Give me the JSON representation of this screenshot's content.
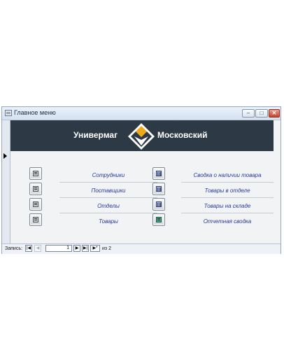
{
  "window": {
    "title": "Главное меню",
    "controls": {
      "minimize": "–",
      "maximize": "□",
      "close": "✕"
    }
  },
  "header": {
    "logo_left": "Универмаг",
    "logo_right": "Московский"
  },
  "menu": {
    "left": [
      {
        "label": "Сотрудники",
        "icon": "form-icon"
      },
      {
        "label": "Поставщики",
        "icon": "form-icon"
      },
      {
        "label": "Отделы",
        "icon": "form-icon"
      },
      {
        "label": "Товары",
        "icon": "form-icon"
      }
    ],
    "right": [
      {
        "label": "Сводка о наличии товара",
        "icon": "report-icon"
      },
      {
        "label": "Товары в отделе",
        "icon": "report-icon"
      },
      {
        "label": "Товары на складе",
        "icon": "report-icon"
      },
      {
        "label": "Отчетная сводка",
        "icon": "book-icon"
      }
    ]
  },
  "navigation": {
    "label": "Запись:",
    "current": "1",
    "of_label": "из",
    "total": "2",
    "buttons": {
      "first": "|◀",
      "prev": "◀",
      "next": "▶",
      "last": "▶|",
      "new": "▶*"
    }
  },
  "colors": {
    "header_bg": "#2d3944",
    "label_text": "#2a3a9a",
    "logo_accent": "#f0a818"
  }
}
